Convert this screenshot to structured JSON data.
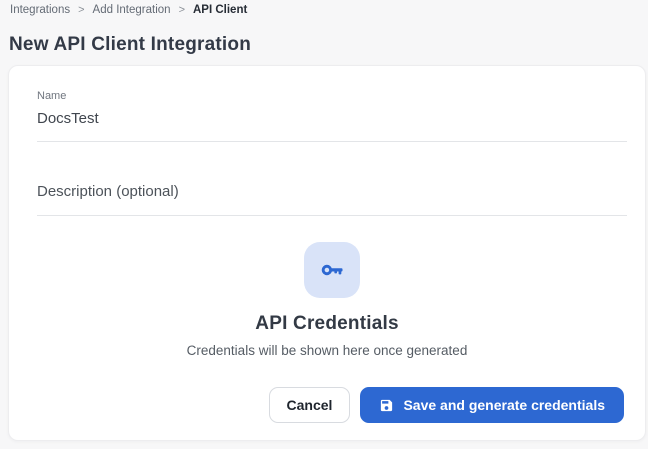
{
  "breadcrumb": {
    "items": [
      "Integrations",
      "Add Integration",
      "API Client"
    ],
    "separator": ">"
  },
  "page": {
    "title": "New API Client Integration"
  },
  "form": {
    "name_label": "Name",
    "name_value": "DocsTest",
    "description_placeholder": "Description (optional)"
  },
  "credentials": {
    "icon": "key-icon",
    "title": "API Credentials",
    "subtitle": "Credentials will be shown here once generated"
  },
  "actions": {
    "cancel_label": "Cancel",
    "save_label": "Save and generate credentials",
    "save_icon": "save-icon"
  },
  "colors": {
    "accent_blue": "#2d68d2",
    "icon_badge_bg": "#d9e3f8",
    "page_bg": "#f7f7f8"
  }
}
